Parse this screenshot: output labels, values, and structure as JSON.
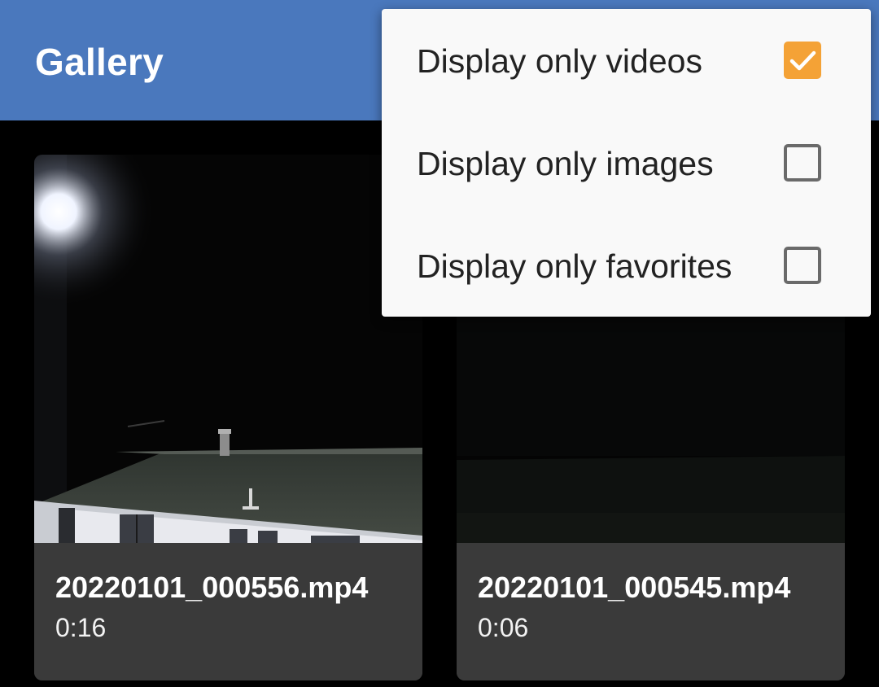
{
  "app_bar": {
    "title": "Gallery"
  },
  "gallery": {
    "items": [
      {
        "name": "20220101_000556.mp4",
        "duration": "0:16"
      },
      {
        "name": "20220101_000545.mp4",
        "duration": "0:06"
      }
    ]
  },
  "filter_menu": {
    "options": [
      {
        "label": "Display only videos",
        "checked": true
      },
      {
        "label": "Display only images",
        "checked": false
      },
      {
        "label": "Display only favorites",
        "checked": false
      }
    ]
  },
  "colors": {
    "app_bar": "#4a78bd",
    "checkbox_checked": "#f4a236",
    "card_info": "#3a3a3a"
  },
  "icons": {
    "check": "checkmark-icon"
  }
}
